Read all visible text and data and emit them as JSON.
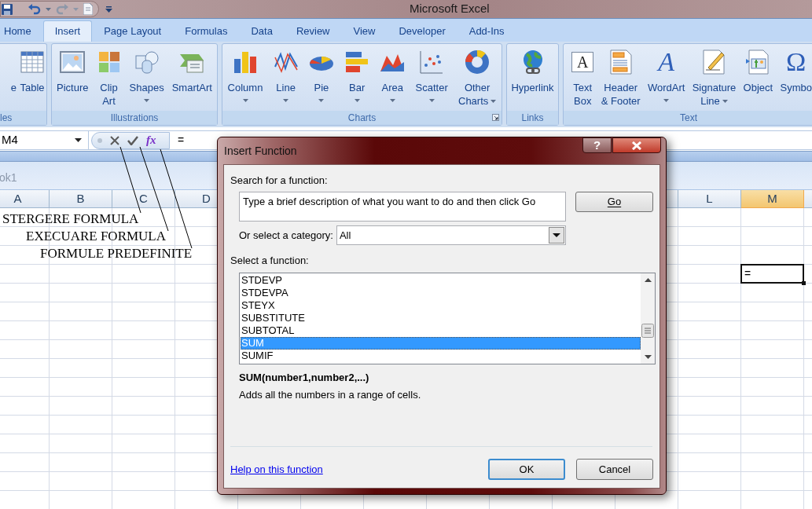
{
  "window": {
    "title": "Microsoft Excel"
  },
  "tabs": [
    {
      "label": "Home",
      "selected": false
    },
    {
      "label": "Insert",
      "selected": true
    },
    {
      "label": "Page Layout",
      "selected": false
    },
    {
      "label": "Formulas",
      "selected": false
    },
    {
      "label": "Data",
      "selected": false
    },
    {
      "label": "Review",
      "selected": false
    },
    {
      "label": "View",
      "selected": false
    },
    {
      "label": "Developer",
      "selected": false
    },
    {
      "label": "Add-Ins",
      "selected": false
    }
  ],
  "ribbon": {
    "groups": [
      {
        "label": "les",
        "buttons": [
          {
            "label": [
              "e"
            ]
          },
          {
            "label": [
              "Table"
            ]
          }
        ]
      },
      {
        "label": "Illustrations",
        "buttons": [
          {
            "label": [
              "Picture"
            ]
          },
          {
            "label": [
              "Clip",
              "Art"
            ]
          },
          {
            "label": [
              "Shapes"
            ],
            "dropdown": true
          },
          {
            "label": [
              "SmartArt"
            ]
          }
        ]
      },
      {
        "label": "Charts",
        "launcher": true,
        "buttons": [
          {
            "label": [
              "Column"
            ],
            "dropdown": true
          },
          {
            "label": [
              "Line"
            ],
            "dropdown": true
          },
          {
            "label": [
              "Pie"
            ],
            "dropdown": true
          },
          {
            "label": [
              "Bar"
            ],
            "dropdown": true
          },
          {
            "label": [
              "Area"
            ],
            "dropdown": true
          },
          {
            "label": [
              "Scatter"
            ],
            "dropdown": true
          },
          {
            "label": [
              "Other",
              "Charts"
            ],
            "dropdown": true
          }
        ]
      },
      {
        "label": "Links",
        "buttons": [
          {
            "label": [
              "Hyperlink"
            ]
          }
        ]
      },
      {
        "label": "Text",
        "buttons": [
          {
            "label": [
              "Text",
              "Box"
            ],
            "glyph": "A"
          },
          {
            "label": [
              "Header",
              "& Footer"
            ]
          },
          {
            "label": [
              "WordArt"
            ],
            "dropdown": true,
            "glyph": "A"
          },
          {
            "label": [
              "Signature",
              "Line"
            ],
            "dropdown": true
          },
          {
            "label": [
              "Object"
            ]
          },
          {
            "label": [
              "Symbo"
            ],
            "glyph": "Ω"
          }
        ]
      }
    ]
  },
  "formula_bar": {
    "name_box": "M4",
    "insert_function": "fx",
    "formula": "="
  },
  "workbook": {
    "title": "ok1"
  },
  "sheet": {
    "columns": [
      {
        "label": "A",
        "selected": false
      },
      {
        "label": "B",
        "selected": false
      },
      {
        "label": "C",
        "selected": false
      },
      {
        "label": "D",
        "selected": false
      },
      {
        "label": "L",
        "selected": false
      },
      {
        "label": "M",
        "selected": true
      }
    ],
    "active_cell": {
      "value": "="
    }
  },
  "annotations": [
    "STERGERE FORMULA",
    "EXECUARE FORMULA",
    "FORMULE PREDEFINITE"
  ],
  "dialog": {
    "title": "Insert Function",
    "help_button": "?",
    "search_label": "Search for a function:",
    "search_value": "Type a brief description of what you want to do and then click Go",
    "go_button": "Go",
    "category_label": "Or select a category:",
    "category_value": "All",
    "function_label": "Select a function:",
    "functions": [
      {
        "name": "STDEVP",
        "selected": false
      },
      {
        "name": "STDEVPA",
        "selected": false
      },
      {
        "name": "STEYX",
        "selected": false
      },
      {
        "name": "SUBSTITUTE",
        "selected": false
      },
      {
        "name": "SUBTOTAL",
        "selected": false
      },
      {
        "name": "SUM",
        "selected": true
      },
      {
        "name": "SUMIF",
        "selected": false
      }
    ],
    "signature": "SUM(number1,number2,...)",
    "description": "Adds all the numbers in a range of cells.",
    "help_link": "Help on this function",
    "buttons": [
      {
        "label": "OK",
        "default": true
      },
      {
        "label": "Cancel",
        "default": false
      }
    ]
  }
}
